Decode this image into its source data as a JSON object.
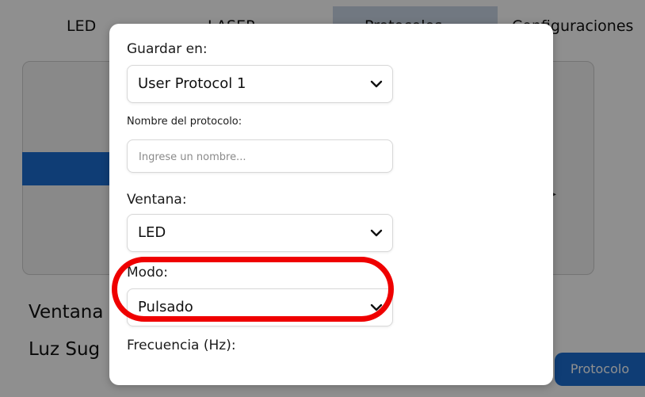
{
  "tabs": [
    "LED",
    "LASER",
    "Protocolos",
    "Configuraciones"
  ],
  "background": {
    "label_ventana": "Ventana",
    "label_luz": "Luz Sug",
    "protocol_button": "Protocolo"
  },
  "modal": {
    "save_in": {
      "label": "Guardar en:",
      "selected": "User Protocol 1"
    },
    "protocol_name": {
      "label": "Nombre del protocolo:",
      "placeholder": "Ingrese un nombre...",
      "value": ""
    },
    "window": {
      "label": "Ventana:",
      "selected": "LED"
    },
    "mode": {
      "label": "Modo:",
      "selected": "Pulsado"
    },
    "frequency": {
      "label": "Frecuencia (Hz):"
    }
  },
  "colors": {
    "accent_blue": "#1c6ed1",
    "highlight_red": "#ef0000"
  },
  "icons": {
    "select_chevron": "chevron-down-icon"
  }
}
